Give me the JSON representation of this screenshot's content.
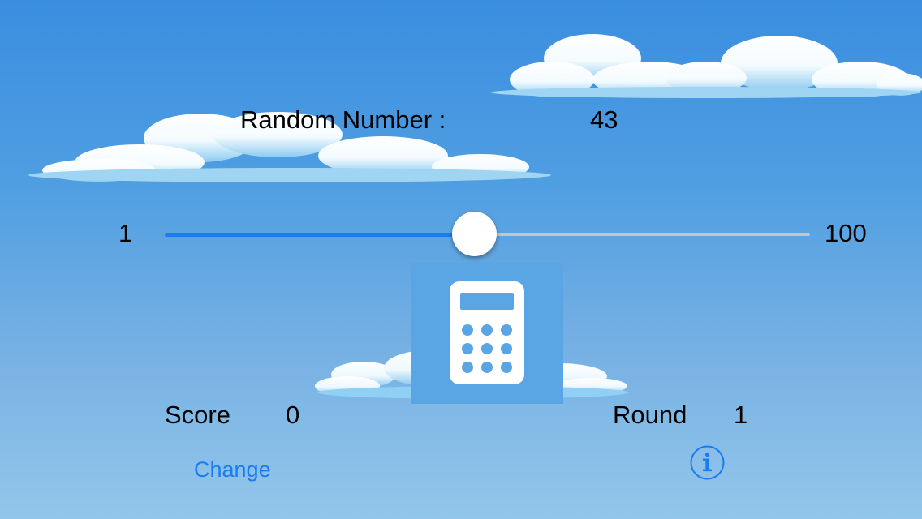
{
  "target": {
    "label": "Random Number :",
    "value": "43"
  },
  "slider": {
    "min_label": "1",
    "max_label": "100",
    "value_fraction": 0.48,
    "min_track_color": "#1a7cf2",
    "max_track_color": "#c6c6c6"
  },
  "hit_button": {
    "icon": "calculator-icon",
    "background_color": "#5aa6e4"
  },
  "score": {
    "label": "Score",
    "value": "0"
  },
  "round": {
    "label": "Round",
    "value": "1"
  },
  "change_link": {
    "label": "Change"
  },
  "info_button": {
    "icon": "info-icon"
  },
  "colors": {
    "accent": "#1a7cf2",
    "sky_top": "#3a8ee0",
    "sky_bottom": "#93c6ea"
  }
}
